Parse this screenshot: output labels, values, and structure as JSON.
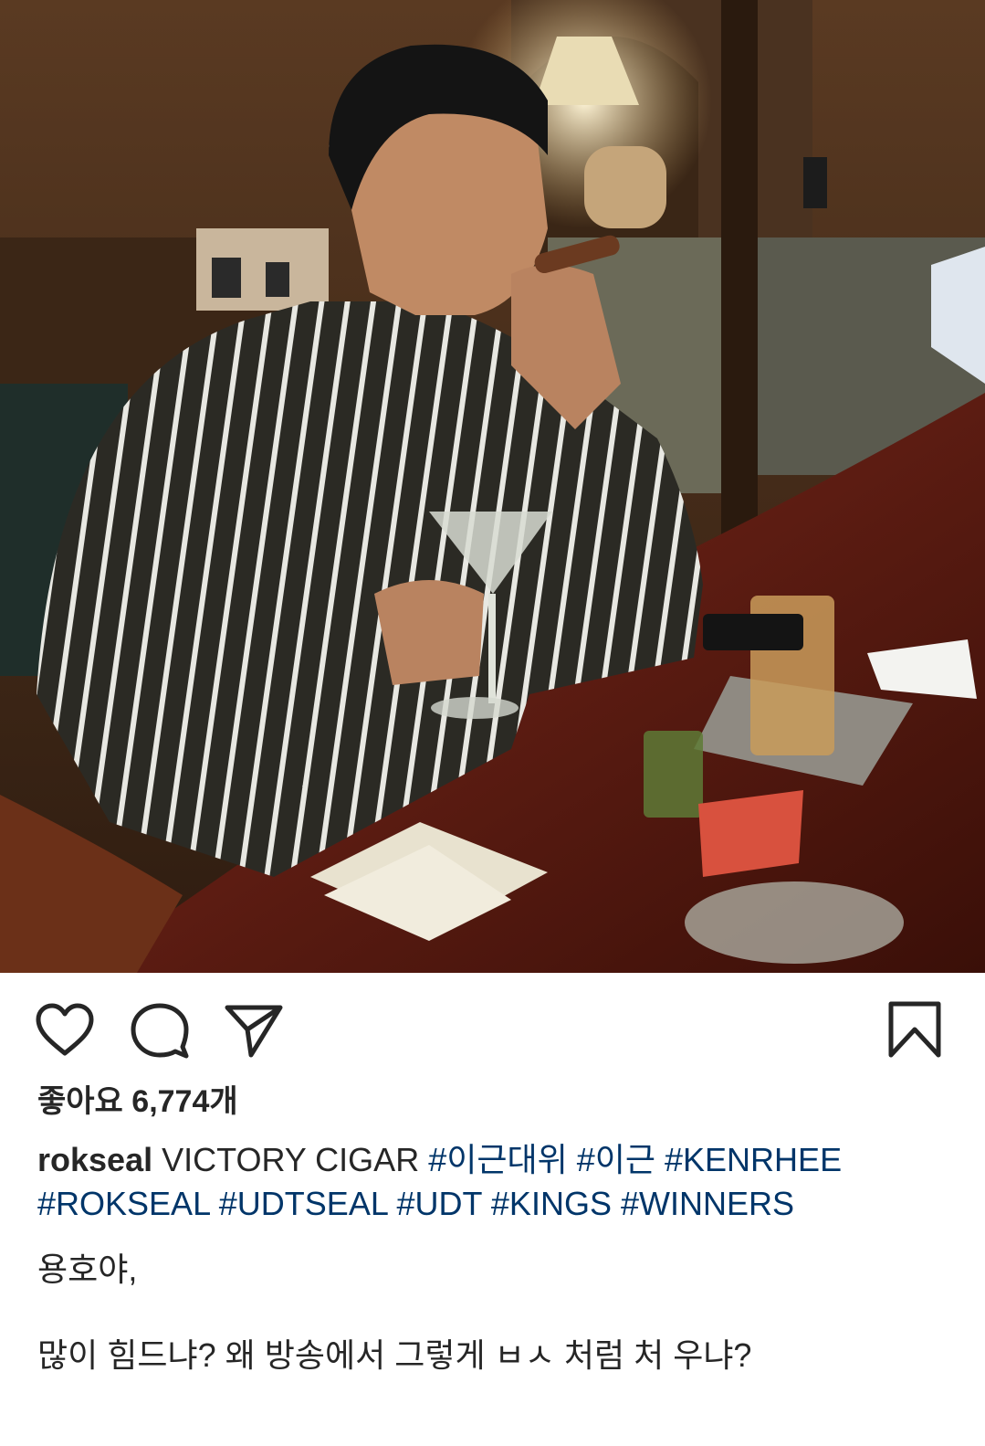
{
  "post": {
    "photo_icon": "photo",
    "likes_label": "좋아요 6,774개",
    "username": "rokseal",
    "caption_text": "VICTORY CIGAR",
    "hashtags": [
      "#이근대위",
      "#이근",
      "#KENRHEE",
      "#ROKSEAL",
      "#UDTSEAL",
      "#UDT",
      "#KINGS",
      "#WINNERS"
    ],
    "comment_lines": [
      "용호야,",
      "많이 힘드냐? 왜 방송에서 그렇게 ㅂㅅ 처럼 처 우냐?"
    ]
  },
  "actions": {
    "like_icon": "heart-icon",
    "comment_icon": "comment-icon",
    "share_icon": "send-icon",
    "save_icon": "bookmark-icon"
  },
  "colors": {
    "text": "#262626",
    "hashtag": "#003569",
    "background": "#ffffff"
  }
}
